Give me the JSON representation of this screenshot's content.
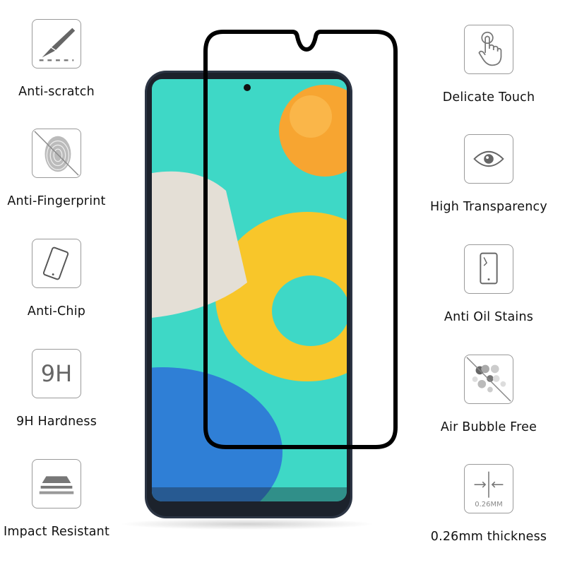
{
  "features_left": [
    {
      "label": "Anti-scratch",
      "icon": "scalpel-icon"
    },
    {
      "label": "Anti-Fingerprint",
      "icon": "fingerprint-crossed-icon"
    },
    {
      "label": "Anti-Chip",
      "icon": "phone-chip-icon"
    },
    {
      "label": "9H Hardness",
      "icon": "hardness-9h-icon",
      "icon_text": "9H"
    },
    {
      "label": "Impact Resistant",
      "icon": "impact-layers-icon"
    }
  ],
  "features_right": [
    {
      "label": "Delicate Touch",
      "icon": "touch-hand-icon"
    },
    {
      "label": "High Transparency",
      "icon": "eye-icon"
    },
    {
      "label": "Anti Oil Stains",
      "icon": "phone-stain-icon"
    },
    {
      "label": "Air Bubble Free",
      "icon": "bubbles-crossed-icon"
    },
    {
      "label": "0.26mm thickness",
      "icon": "thickness-icon",
      "icon_text": "0.26MM"
    }
  ],
  "colors": {
    "screen": "#3ed8c6",
    "frame": "#000000",
    "orange": "#f7a531",
    "yellow": "#f8c62a",
    "blue": "#2f7fd6"
  }
}
